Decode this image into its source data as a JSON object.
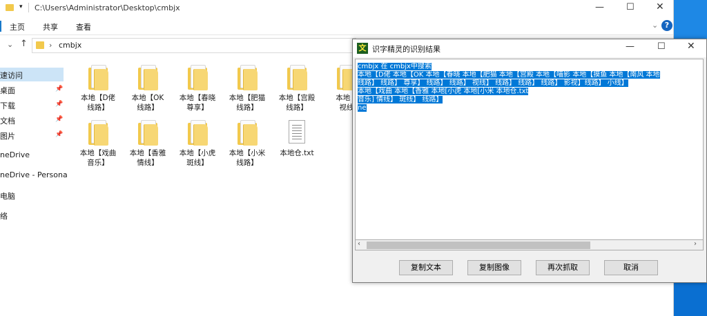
{
  "explorer": {
    "path": "C:\\Users\\Administrator\\Desktop\\cmbjx",
    "ribbon_tabs": [
      "主页",
      "共享",
      "查看"
    ],
    "address_folder": "cmbjx",
    "nav": [
      {
        "label": "速访问",
        "pinned": false
      },
      {
        "label": "桌面",
        "pinned": true
      },
      {
        "label": "下载",
        "pinned": true
      },
      {
        "label": "文档",
        "pinned": true
      },
      {
        "label": "图片",
        "pinned": true
      },
      {
        "label": "neDrive",
        "pinned": false
      },
      {
        "label": "neDrive - Persona",
        "pinned": false
      },
      {
        "label": "电脑",
        "pinned": false
      },
      {
        "label": "络",
        "pinned": false
      }
    ],
    "files_row1": [
      {
        "line1": "本地【D佬",
        "line2": "线路】"
      },
      {
        "line1": "本地【OK",
        "line2": "线路】"
      },
      {
        "line1": "本地【春晓",
        "line2": "尊享】"
      },
      {
        "line1": "本地【肥猫",
        "line2": "线路】"
      },
      {
        "line1": "本地【宫殿",
        "line2": "线路】"
      },
      {
        "line1": "本地【",
        "line2": "视线"
      }
    ],
    "files_row2": [
      {
        "line1": "本地【戏曲",
        "line2": "音乐】"
      },
      {
        "line1": "本地【香雅",
        "line2": "情线】"
      },
      {
        "line1": "本地【小虎",
        "line2": "斑线】"
      },
      {
        "line1": "本地【小米",
        "line2": "线路】"
      },
      {
        "line1": "本地仓.txt",
        "line2": ""
      }
    ],
    "pin_glyph": "📌"
  },
  "dialog": {
    "title": "识字精灵的识别结果",
    "icon_char": "文",
    "lines": [
      "cmbjx 在 cmbjx中搜索",
      "本地【D佬 本地【OK 本地【春晓 本地【肥猫 本地【宫殿 本地【喵影 本地【摸鱼 本地【南风 本地",
      "线路】 线路】 尊享】 线路】 线路】 视线】 线路】 线路】 线路】 影视】线路】 小线】",
      "本地【戏曲 本地【香雅 本地[小虎 本地[小米 本地仓.txt",
      "音乐] 情线】 斑线】 线路】",
      "ne"
    ],
    "buttons": [
      "复制文本",
      "复制图像",
      "再次抓取",
      "取消"
    ]
  }
}
